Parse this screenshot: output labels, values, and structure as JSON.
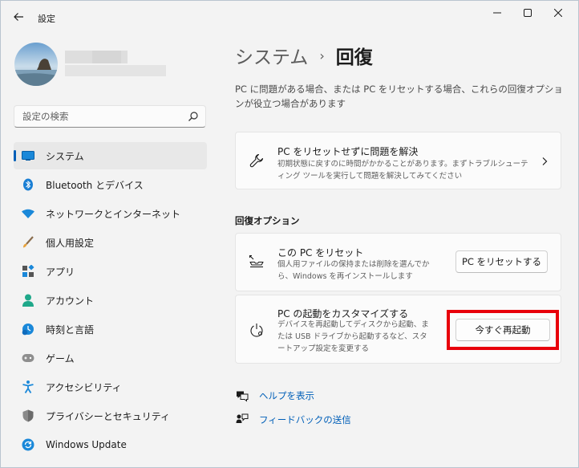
{
  "window": {
    "title": "設定",
    "controls": {
      "minimize": "minimize",
      "maximize": "maximize",
      "close": "close"
    }
  },
  "sidebar": {
    "search": {
      "placeholder": "設定の検索",
      "value": ""
    },
    "items": [
      {
        "label": "システム",
        "icon": "system-icon",
        "active": true
      },
      {
        "label": "Bluetooth とデバイス",
        "icon": "bluetooth-icon"
      },
      {
        "label": "ネットワークとインターネット",
        "icon": "wifi-icon"
      },
      {
        "label": "個人用設定",
        "icon": "brush-icon"
      },
      {
        "label": "アプリ",
        "icon": "apps-icon"
      },
      {
        "label": "アカウント",
        "icon": "account-icon"
      },
      {
        "label": "時刻と言語",
        "icon": "time-language-icon"
      },
      {
        "label": "ゲーム",
        "icon": "gamepad-icon"
      },
      {
        "label": "アクセシビリティ",
        "icon": "accessibility-icon"
      },
      {
        "label": "プライバシーとセキュリティ",
        "icon": "shield-icon"
      },
      {
        "label": "Windows Update",
        "icon": "windows-update-icon"
      }
    ]
  },
  "main": {
    "breadcrumb": {
      "parent": "システム",
      "separator": "›",
      "current": "回復"
    },
    "description": "PC に問題がある場合、または PC をリセットする場合、これらの回復オプションが役立つ場合があります",
    "troubleshoot_card": {
      "title": "PC をリセットせずに問題を解決",
      "subtitle": "初期状態に戻すのに時間がかかることがあります。まずトラブルシューティング ツールを実行して問題を解決してみてください"
    },
    "section_title": "回復オプション",
    "reset_card": {
      "title": "この PC をリセット",
      "subtitle": "個人用ファイルの保持または削除を選んでから、Windows を再インストールします",
      "button": "PC をリセットする"
    },
    "startup_card": {
      "title": "PC の起動をカスタマイズする",
      "subtitle": "デバイスを再起動してディスクから起動、または USB ドライブから起動するなど、スタートアップ設定を変更する",
      "button": "今すぐ再起動"
    },
    "links": [
      {
        "label": "ヘルプを表示",
        "icon": "help-icon"
      },
      {
        "label": "フィードバックの送信",
        "icon": "feedback-icon"
      }
    ]
  },
  "colors": {
    "accent": "#005fb8",
    "highlight": "#e8000b",
    "background": "#f3f3f3"
  }
}
